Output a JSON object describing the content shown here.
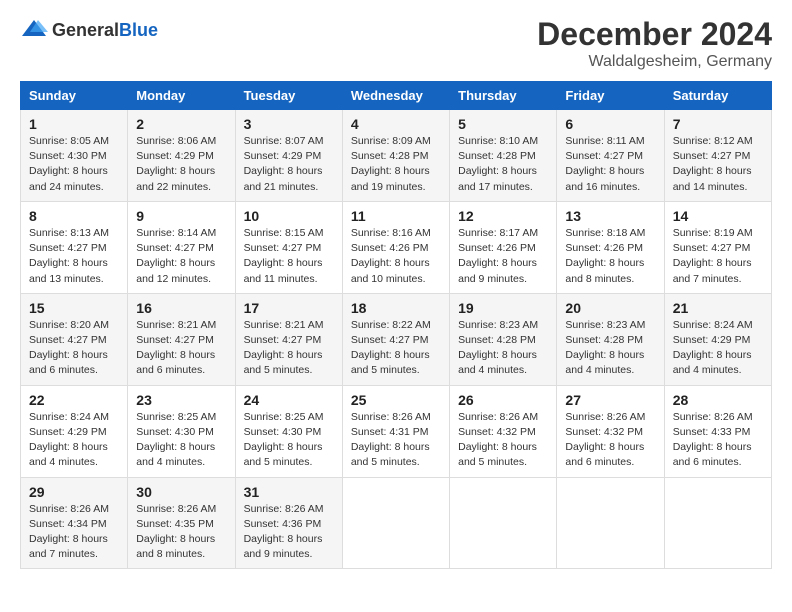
{
  "header": {
    "logo_general": "General",
    "logo_blue": "Blue",
    "month_title": "December 2024",
    "location": "Waldalgesheim, Germany"
  },
  "days_of_week": [
    "Sunday",
    "Monday",
    "Tuesday",
    "Wednesday",
    "Thursday",
    "Friday",
    "Saturday"
  ],
  "weeks": [
    [
      {
        "day": "1",
        "sunrise": "8:05 AM",
        "sunset": "4:30 PM",
        "daylight": "8 hours and 24 minutes."
      },
      {
        "day": "2",
        "sunrise": "8:06 AM",
        "sunset": "4:29 PM",
        "daylight": "8 hours and 22 minutes."
      },
      {
        "day": "3",
        "sunrise": "8:07 AM",
        "sunset": "4:29 PM",
        "daylight": "8 hours and 21 minutes."
      },
      {
        "day": "4",
        "sunrise": "8:09 AM",
        "sunset": "4:28 PM",
        "daylight": "8 hours and 19 minutes."
      },
      {
        "day": "5",
        "sunrise": "8:10 AM",
        "sunset": "4:28 PM",
        "daylight": "8 hours and 17 minutes."
      },
      {
        "day": "6",
        "sunrise": "8:11 AM",
        "sunset": "4:27 PM",
        "daylight": "8 hours and 16 minutes."
      },
      {
        "day": "7",
        "sunrise": "8:12 AM",
        "sunset": "4:27 PM",
        "daylight": "8 hours and 14 minutes."
      }
    ],
    [
      {
        "day": "8",
        "sunrise": "8:13 AM",
        "sunset": "4:27 PM",
        "daylight": "8 hours and 13 minutes."
      },
      {
        "day": "9",
        "sunrise": "8:14 AM",
        "sunset": "4:27 PM",
        "daylight": "8 hours and 12 minutes."
      },
      {
        "day": "10",
        "sunrise": "8:15 AM",
        "sunset": "4:27 PM",
        "daylight": "8 hours and 11 minutes."
      },
      {
        "day": "11",
        "sunrise": "8:16 AM",
        "sunset": "4:26 PM",
        "daylight": "8 hours and 10 minutes."
      },
      {
        "day": "12",
        "sunrise": "8:17 AM",
        "sunset": "4:26 PM",
        "daylight": "8 hours and 9 minutes."
      },
      {
        "day": "13",
        "sunrise": "8:18 AM",
        "sunset": "4:26 PM",
        "daylight": "8 hours and 8 minutes."
      },
      {
        "day": "14",
        "sunrise": "8:19 AM",
        "sunset": "4:27 PM",
        "daylight": "8 hours and 7 minutes."
      }
    ],
    [
      {
        "day": "15",
        "sunrise": "8:20 AM",
        "sunset": "4:27 PM",
        "daylight": "8 hours and 6 minutes."
      },
      {
        "day": "16",
        "sunrise": "8:21 AM",
        "sunset": "4:27 PM",
        "daylight": "8 hours and 6 minutes."
      },
      {
        "day": "17",
        "sunrise": "8:21 AM",
        "sunset": "4:27 PM",
        "daylight": "8 hours and 5 minutes."
      },
      {
        "day": "18",
        "sunrise": "8:22 AM",
        "sunset": "4:27 PM",
        "daylight": "8 hours and 5 minutes."
      },
      {
        "day": "19",
        "sunrise": "8:23 AM",
        "sunset": "4:28 PM",
        "daylight": "8 hours and 4 minutes."
      },
      {
        "day": "20",
        "sunrise": "8:23 AM",
        "sunset": "4:28 PM",
        "daylight": "8 hours and 4 minutes."
      },
      {
        "day": "21",
        "sunrise": "8:24 AM",
        "sunset": "4:29 PM",
        "daylight": "8 hours and 4 minutes."
      }
    ],
    [
      {
        "day": "22",
        "sunrise": "8:24 AM",
        "sunset": "4:29 PM",
        "daylight": "8 hours and 4 minutes."
      },
      {
        "day": "23",
        "sunrise": "8:25 AM",
        "sunset": "4:30 PM",
        "daylight": "8 hours and 4 minutes."
      },
      {
        "day": "24",
        "sunrise": "8:25 AM",
        "sunset": "4:30 PM",
        "daylight": "8 hours and 5 minutes."
      },
      {
        "day": "25",
        "sunrise": "8:26 AM",
        "sunset": "4:31 PM",
        "daylight": "8 hours and 5 minutes."
      },
      {
        "day": "26",
        "sunrise": "8:26 AM",
        "sunset": "4:32 PM",
        "daylight": "8 hours and 5 minutes."
      },
      {
        "day": "27",
        "sunrise": "8:26 AM",
        "sunset": "4:32 PM",
        "daylight": "8 hours and 6 minutes."
      },
      {
        "day": "28",
        "sunrise": "8:26 AM",
        "sunset": "4:33 PM",
        "daylight": "8 hours and 6 minutes."
      }
    ],
    [
      {
        "day": "29",
        "sunrise": "8:26 AM",
        "sunset": "4:34 PM",
        "daylight": "8 hours and 7 minutes."
      },
      {
        "day": "30",
        "sunrise": "8:26 AM",
        "sunset": "4:35 PM",
        "daylight": "8 hours and 8 minutes."
      },
      {
        "day": "31",
        "sunrise": "8:26 AM",
        "sunset": "4:36 PM",
        "daylight": "8 hours and 9 minutes."
      },
      null,
      null,
      null,
      null
    ]
  ],
  "labels": {
    "sunrise": "Sunrise:",
    "sunset": "Sunset:",
    "daylight": "Daylight:"
  }
}
